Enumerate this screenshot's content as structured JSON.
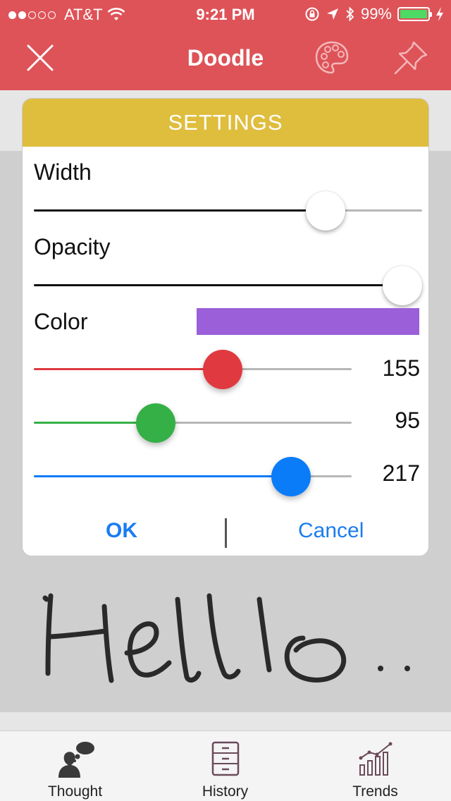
{
  "status_bar": {
    "carrier": "AT&T",
    "time": "9:21 PM",
    "battery": "99%",
    "signal_dots_filled": 2,
    "signal_dots_total": 5
  },
  "nav": {
    "title": "Doodle",
    "close_icon": "close-icon",
    "palette_icon": "palette-icon",
    "pin_icon": "pin-icon"
  },
  "settings": {
    "header": "SETTINGS",
    "width_label": "Width",
    "width_value_fraction": 0.75,
    "opacity_label": "Opacity",
    "opacity_value_fraction": 1.0,
    "color_label": "Color",
    "color_hex": "#9b5fd9",
    "red": "155",
    "green": "95",
    "blue": "217",
    "ok": "OK",
    "cancel": "Cancel"
  },
  "colors": {
    "header_bg": "#de5358",
    "settings_header_bg": "#dfbd3d",
    "red_slider": "#e03a40",
    "green_slider": "#35b047",
    "blue_slider": "#0a7cf8",
    "link_blue": "#1a7cf0"
  },
  "tabs": [
    {
      "label": "Thought",
      "icon": "thought-bubble-icon"
    },
    {
      "label": "History",
      "icon": "file-cabinet-icon"
    },
    {
      "label": "Trends",
      "icon": "trend-chart-icon"
    }
  ]
}
